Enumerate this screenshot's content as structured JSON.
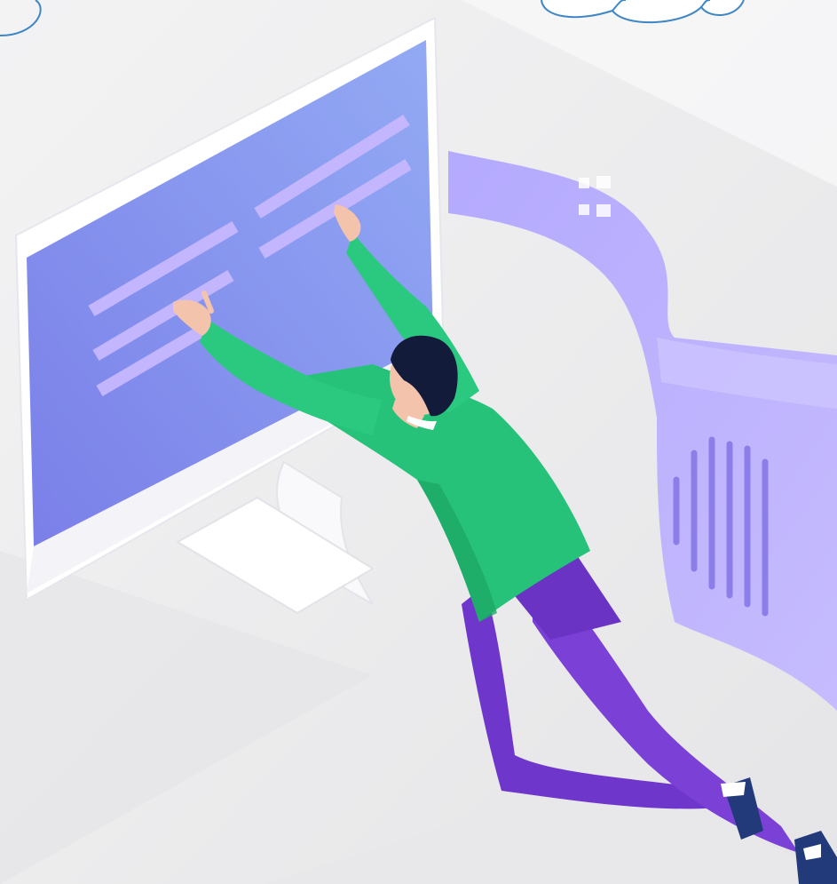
{
  "palette": {
    "background": "#eeeeef",
    "monitor_frame": "#ffffff",
    "screen_gradient_start": "#7f83ea",
    "screen_gradient_end": "#8ea6f3",
    "ribbon": "#b5a9ff",
    "shirt": "#27c47a",
    "pants": "#6c35c9",
    "hair": "#141c3d",
    "skin": "#f5c4ad",
    "cloud_stroke": "#3f86c4"
  },
  "illustration": {
    "subject": "person-reaching-monitor",
    "icons": [
      "cloud-icon",
      "grid-icon",
      "bar-chart-icon"
    ]
  }
}
